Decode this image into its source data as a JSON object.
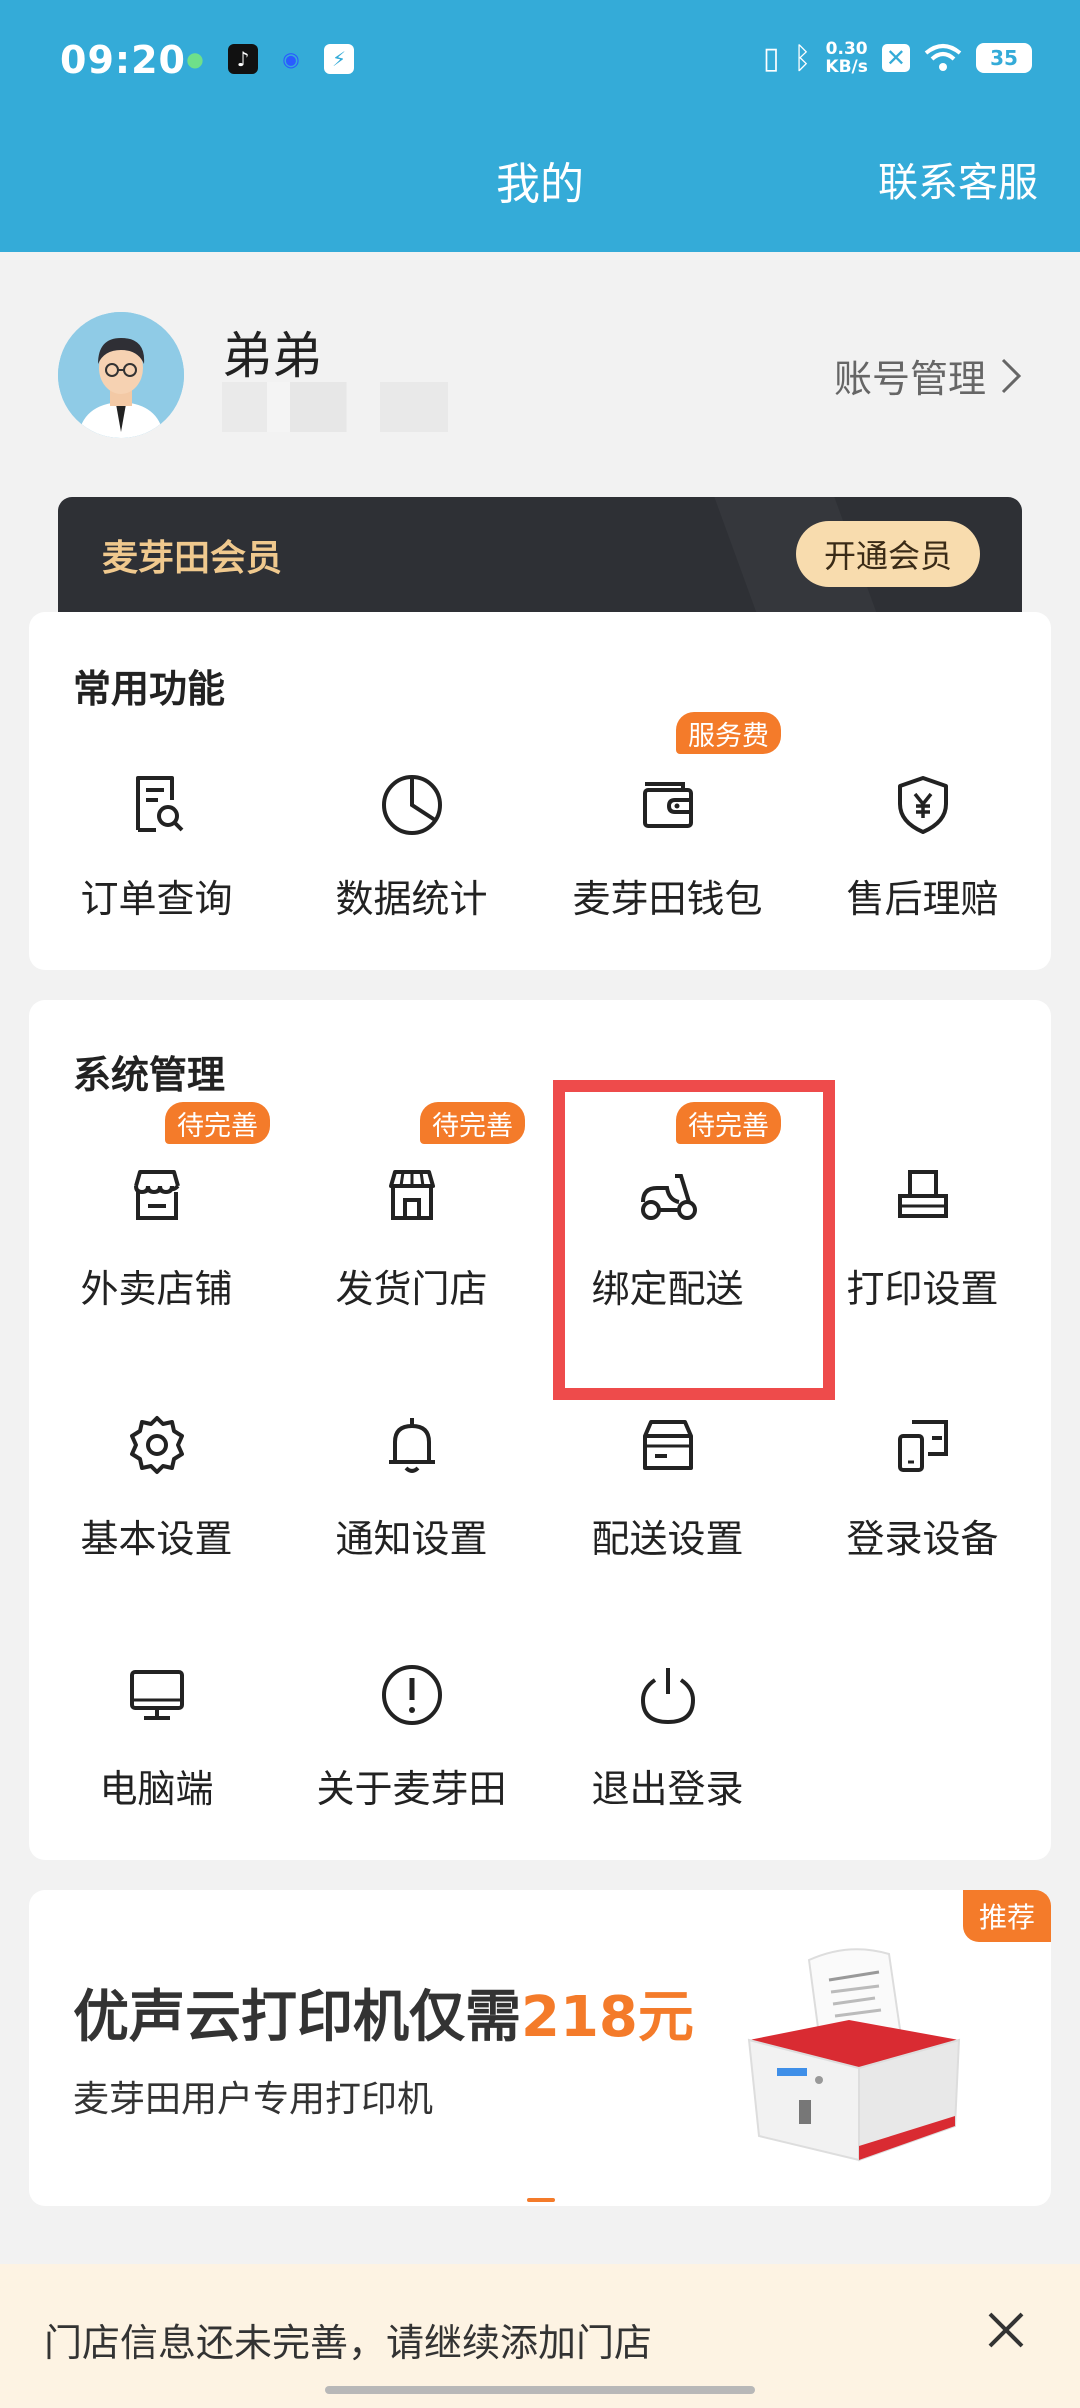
{
  "status_bar": {
    "time": "09:20",
    "net_speed_top": "0.30",
    "net_speed_bottom": "KB/s",
    "battery": "35"
  },
  "header": {
    "title": "我的",
    "contact": "联系客服"
  },
  "profile": {
    "name": "弟弟",
    "account_mgmt": "账号管理"
  },
  "member": {
    "title": "麦芽田会员",
    "button": "开通会员"
  },
  "common": {
    "title": "常用功能",
    "items": [
      {
        "label": "订单查询",
        "icon": "order-search-icon"
      },
      {
        "label": "数据统计",
        "icon": "pie-chart-icon"
      },
      {
        "label": "麦芽田钱包",
        "icon": "wallet-icon",
        "badge": "服务费"
      },
      {
        "label": "售后理赔",
        "icon": "shield-yen-icon"
      }
    ]
  },
  "system": {
    "title": "系统管理",
    "items": [
      {
        "label": "外卖店铺",
        "icon": "store-icon",
        "badge": "待完善"
      },
      {
        "label": "发货门店",
        "icon": "shop-icon",
        "badge": "待完善"
      },
      {
        "label": "绑定配送",
        "icon": "scooter-icon",
        "badge": "待完善"
      },
      {
        "label": "打印设置",
        "icon": "printer-icon"
      },
      {
        "label": "基本设置",
        "icon": "gear-icon"
      },
      {
        "label": "通知设置",
        "icon": "bell-icon"
      },
      {
        "label": "配送设置",
        "icon": "box-icon"
      },
      {
        "label": "登录设备",
        "icon": "devices-icon"
      },
      {
        "label": "电脑端",
        "icon": "monitor-icon"
      },
      {
        "label": "关于麦芽田",
        "icon": "info-icon"
      },
      {
        "label": "退出登录",
        "icon": "power-icon"
      }
    ]
  },
  "banner": {
    "title_prefix": "优声云打印机仅需",
    "price": "218元",
    "subtitle": "麦芽田用户专用打印机",
    "tag": "推荐"
  },
  "notice": {
    "text": "门店信息还未完善，请继续添加门店"
  },
  "colors": {
    "header": "#34abd8",
    "accent": "#f47b2a",
    "highlight": "#ee4b4b"
  }
}
